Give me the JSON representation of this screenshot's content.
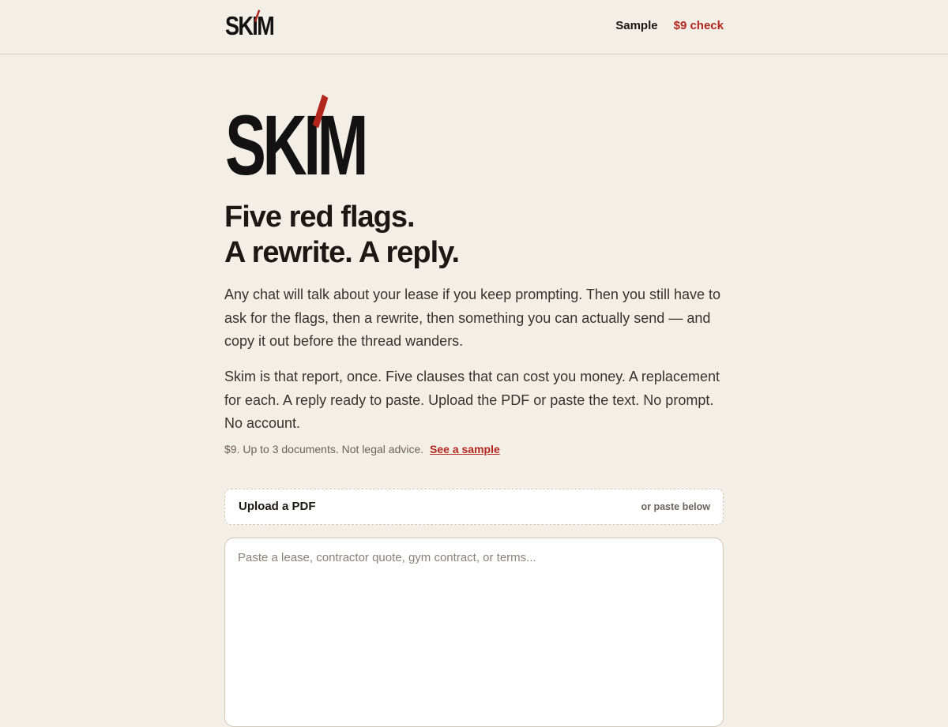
{
  "header": {
    "logo_text_pre": "SK",
    "logo_text_i": "I",
    "logo_text_post": "M",
    "nav": {
      "sample": "Sample",
      "check": "$9 check"
    }
  },
  "hero": {
    "logo_text_pre": "SK",
    "logo_text_i": "I",
    "logo_text_post": "M",
    "headline_line1": "Five red flags.",
    "headline_line2": "A rewrite. A reply.",
    "para1": "Any chat will talk about your lease if you keep prompting. Then you still have to ask for the flags, then a rewrite, then something you can actually send — and copy it out before the thread wanders.",
    "para2": "Skim is that report, once. Five clauses that can cost you money. A replacement for each. A reply ready to paste. Upload the PDF or paste the text. No prompt. No account.",
    "fineprint": "$9. Up to 3 documents. Not legal advice.",
    "sample_link": "See a sample"
  },
  "upload": {
    "label": "Upload a PDF",
    "hint": "or paste below"
  },
  "paste": {
    "placeholder": "Paste a lease, contractor quote, gym contract, or terms..."
  },
  "colors": {
    "background": "#f3eee6",
    "accent": "#b3261e",
    "text": "#1c1713"
  }
}
